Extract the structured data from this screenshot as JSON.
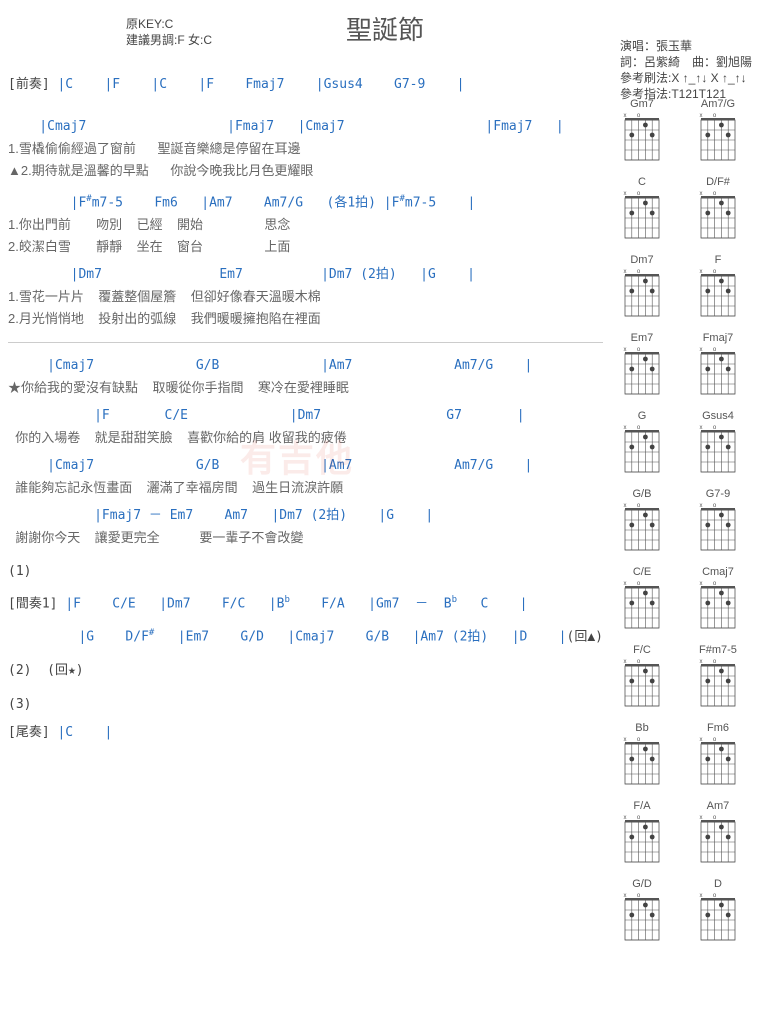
{
  "title": "聖誕節",
  "key_orig": "原KEY:C",
  "key_suggest": "建議男調:F 女:C",
  "credit_singer": "演唱：張玉華",
  "credit_writer": "詞：呂紫綺　曲：劉旭陽",
  "credit_strum": "參考刷法:X ↑_↑↓ X ↑_↑↓",
  "credit_finger": "參考指法:T121T121",
  "intro_label": "[前奏]",
  "intro_chords": "|C    |F    |C    |F    Fmaj7    |Gsus4    G7-9    |",
  "v_chords1": "    |Cmaj7                  |Fmaj7   |Cmaj7                  |Fmaj7   |",
  "v1a": "1.雪橇偷偷經過了窗前      聖誕音樂總是停留在耳邊",
  "v2a": "▲2.期待就是溫馨的早點      你說今晚我比月色更耀眼",
  "v_chords2_pre": "        |F",
  "v_chords2_a": "m7-5    Fm6   |Am7    Am7/G   (各1拍) |F",
  "v_chords2_b": "m7-5    |",
  "v1b": "1.你出門前       吻別    已經    開始                 思念",
  "v2b": "2.皎潔白雪       靜靜    坐在    窗台                 上面",
  "v_chords3": "        |Dm7               Em7          |Dm7 (2拍)   |G    |",
  "v1c": "1.雪花一片片    覆蓋整個屋簷    但卻好像春天溫暖木棉",
  "v2c": "2.月光悄悄地    投射出的弧線    我們暖暖擁抱陷在裡面",
  "c_chords1": "     |Cmaj7             G/B             |Am7             Am7/G    |",
  "c1": "★你給我的愛沒有缺點    取暖從你手指間    寒冷在愛裡睡眠",
  "c_chords2": "           |F       C/E             |Dm7                G7       |",
  "c2": "  你的入場卷    就是甜甜笑臉    喜歡你給的肩 收留我的疲倦",
  "c_chords3": "     |Cmaj7             G/B             |Am7             Am7/G    |",
  "c3": "  誰能夠忘記永恆畫面    灑滿了幸福房間    過生日流淚許願",
  "c_chords4": "           |Fmaj7 － Em7    Am7   |Dm7 (2拍)    |G    |",
  "c4": "  謝謝你今天    讓愛更完全           要一輩子不會改變",
  "mark1": "(1)",
  "inter_label": "[間奏1]",
  "inter1a": "|F    C/E   |Dm7    F/C   |B",
  "inter1b": "    F/A   |Gm7  －  B",
  "inter1c": "   C    |",
  "inter2a": "|G    D/F",
  "inter2b": "   |Em7    G/D   |Cmaj7    G/B   |Am7 (2拍)   |D    |",
  "ret1": "(回▲)",
  "mark2": "(2)  (回★)",
  "mark3": "(3)",
  "outro_label": "[尾奏]",
  "outro_chords": "|C    |",
  "watermark": "有吉他",
  "diagrams": [
    "Gm7",
    "Am7/G",
    "C",
    "D/F#",
    "Dm7",
    "F",
    "Em7",
    "Fmaj7",
    "G",
    "Gsus4",
    "G/B",
    "G7-9",
    "C/E",
    "Cmaj7",
    "F/C",
    "F#m7-5",
    "Bb",
    "Fm6",
    "F/A",
    "Am7",
    "G/D",
    "D"
  ]
}
